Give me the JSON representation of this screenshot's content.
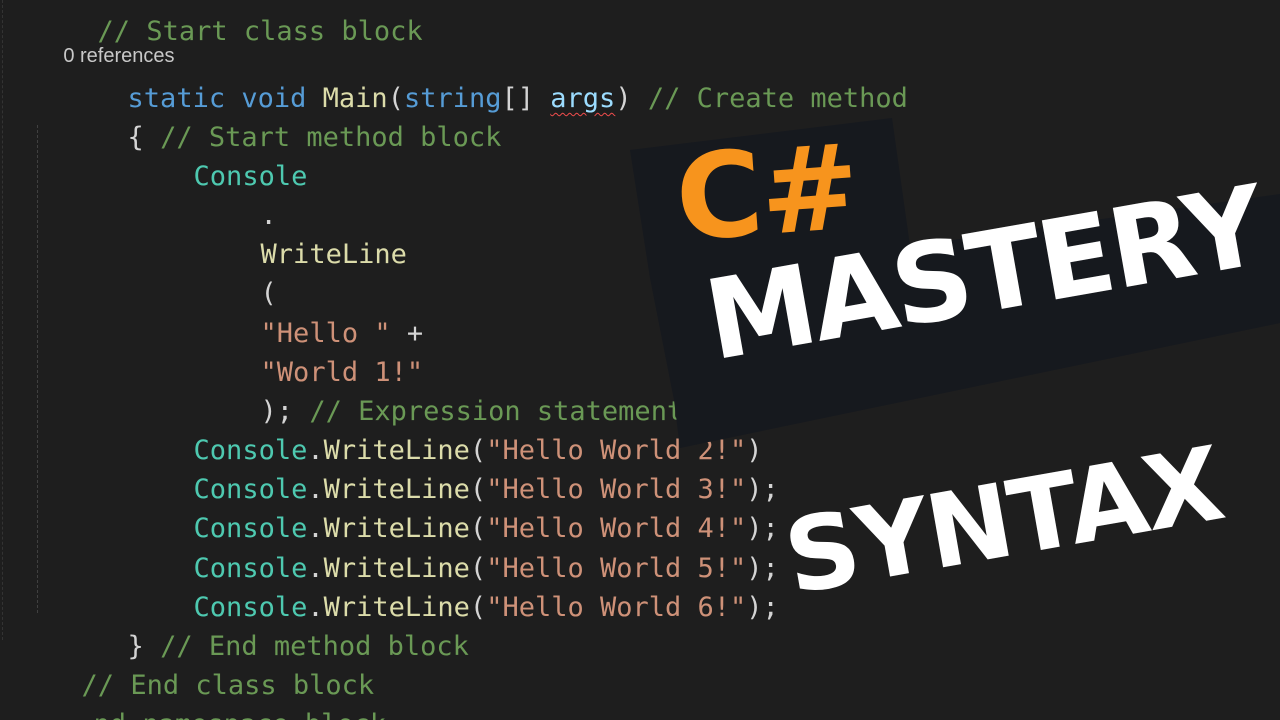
{
  "editor": {
    "line_top_partial": {
      "text": "// Start class block"
    },
    "codelens": {
      "text": "0 references"
    },
    "line_main": {
      "kw_static": "static",
      "kw_void": "void",
      "fn_main": "Main",
      "open_paren": "(",
      "kw_string": "string",
      "brackets": "[]",
      "param_args": "args",
      "close_paren": ")",
      "comment": "// Create method"
    },
    "line_open_brace": {
      "brace": "{",
      "comment": "// Start method block"
    },
    "line_console": {
      "type": "Console"
    },
    "line_dot": {
      "text": "."
    },
    "line_writeline": {
      "text": "WriteLine"
    },
    "line_paren": {
      "text": "("
    },
    "line_hello": {
      "str": "\"Hello \"",
      "op": "+"
    },
    "line_world": {
      "str": "\"World 1!\""
    },
    "line_close_stmt": {
      "punct": ");",
      "comment": "// Expression statement"
    },
    "calls": [
      {
        "type": "Console",
        "dot": ".",
        "method": "WriteLine",
        "open": "(",
        "str": "\"Hello World 2!\"",
        "close": ")"
      },
      {
        "type": "Console",
        "dot": ".",
        "method": "WriteLine",
        "open": "(",
        "str": "\"Hello World 3!\"",
        "close": ");"
      },
      {
        "type": "Console",
        "dot": ".",
        "method": "WriteLine",
        "open": "(",
        "str": "\"Hello World 4!\"",
        "close": ");"
      },
      {
        "type": "Console",
        "dot": ".",
        "method": "WriteLine",
        "open": "(",
        "str": "\"Hello World 5!\"",
        "close": ");"
      },
      {
        "type": "Console",
        "dot": ".",
        "method": "WriteLine",
        "open": "(",
        "str": "\"Hello World 6!\"",
        "close": ");"
      }
    ],
    "line_close_brace": {
      "brace": "}",
      "comment": "// End method block"
    },
    "line_end_class": {
      "comment": "// End class block"
    },
    "line_end_namespace": {
      "pre": "nd",
      "word": "namespace",
      "post": "block"
    }
  },
  "title": {
    "csharp": "C#",
    "mastery": "MASTERY",
    "syntax": "SYNTAX"
  },
  "colors": {
    "background": "#1e1e1e",
    "keyword": "#569cd6",
    "type": "#4ec9b0",
    "method": "#dcdcaa",
    "parameter": "#9cdcfe",
    "comment": "#6a9955",
    "string": "#ce9178",
    "accent_orange": "#f7941d",
    "banner": "#16191e"
  }
}
